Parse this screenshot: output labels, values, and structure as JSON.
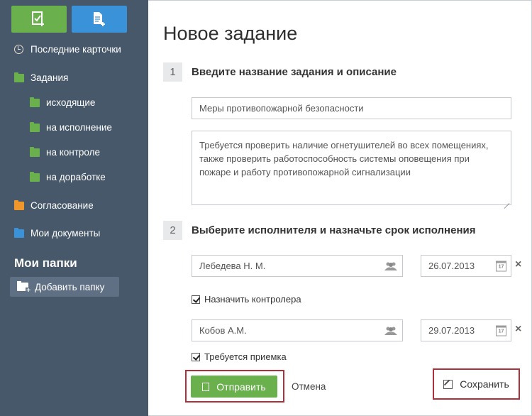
{
  "sidebar": {
    "top_buttons": [
      {
        "icon": "new-task-icon",
        "color": "#6ab04c"
      },
      {
        "icon": "new-document-icon",
        "color": "#3a93d8"
      }
    ],
    "items": [
      {
        "label": "Последние карточки",
        "icon": "clock-icon"
      },
      {
        "label": "Задания",
        "icon": "folder-icon",
        "color": "#6ab04c"
      },
      {
        "label": "исходящие",
        "icon": "folder-icon",
        "color": "#6ab04c"
      },
      {
        "label": "на исполнение",
        "icon": "folder-icon",
        "color": "#6ab04c"
      },
      {
        "label": "на контроле",
        "icon": "folder-icon",
        "color": "#6ab04c"
      },
      {
        "label": "на доработке",
        "icon": "folder-icon",
        "color": "#6ab04c"
      },
      {
        "label": "Согласование",
        "icon": "folder-icon",
        "color": "#f0962a"
      },
      {
        "label": "Мои документы",
        "icon": "folder-icon",
        "color": "#3a93d8"
      }
    ],
    "my_folders_title": "Мои папки",
    "add_folder_label": "Добавить папку"
  },
  "main": {
    "title": "Новое задание",
    "step1": {
      "number": "1",
      "label": "Введите название задания и описание"
    },
    "task_name": "Меры противопожарной безопасности",
    "task_description": "Требуется проверить наличие огнетушителей во всех помещениях, также проверить работоспособность системы оповещения при пожаре и работу противопожарной сигнализации",
    "step2": {
      "number": "2",
      "label": "Выберите исполнителя и назначьте срок исполнения"
    },
    "executor": {
      "name": "Лебедева Н. М.",
      "date": "26.07.2013"
    },
    "assign_controller_label": "Назначить контролера",
    "assign_controller_checked": true,
    "controller": {
      "name": "Кобов А.М.",
      "date": "29.07.2013"
    },
    "acceptance_label": "Требуется приемка",
    "acceptance_checked": true,
    "calendar_day": "17",
    "send_label": "Отправить",
    "cancel_label": "Отмена",
    "save_label": "Сохранить",
    "highlight_color": "#b0303a"
  }
}
